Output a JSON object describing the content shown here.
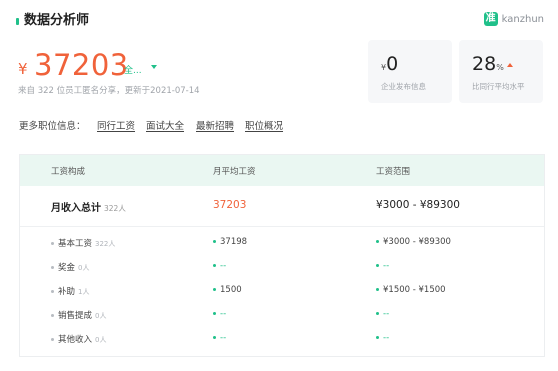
{
  "header": {
    "title": "数据分析师",
    "brand": "kanzhun",
    "brand_logo": "准"
  },
  "summary": {
    "currency": "¥",
    "salary": "37203",
    "region": "全...",
    "subline": "来自 322 位员工匿名分享，更新于2021-07-14"
  },
  "stats": [
    {
      "prefix": "¥",
      "value": "0",
      "unit": "",
      "label": "企业发布信息"
    },
    {
      "prefix": "",
      "value": "28",
      "unit": "%",
      "label": "比同行平均水平",
      "trend": "up"
    }
  ],
  "more": {
    "label": "更多职位信息：",
    "links": [
      "同行工资",
      "面试大全",
      "最新招聘",
      "职位概况"
    ]
  },
  "table": {
    "headers": [
      "工资构成",
      "月平均工资",
      "工资范围"
    ],
    "total": {
      "label": "月收入总计",
      "count": "322人",
      "avg": "37203",
      "range": "¥3000 - ¥89300"
    },
    "rows": [
      {
        "name": "基本工资",
        "count": "322人",
        "avg": "37198",
        "range": "¥3000 - ¥89300"
      },
      {
        "name": "奖金",
        "count": "0人",
        "avg": "--",
        "range": "--"
      },
      {
        "name": "补助",
        "count": "1人",
        "avg": "1500",
        "range": "¥1500 - ¥1500"
      },
      {
        "name": "销售提成",
        "count": "0人",
        "avg": "--",
        "range": "--"
      },
      {
        "name": "其他收入",
        "count": "0人",
        "avg": "--",
        "range": "--"
      }
    ]
  },
  "colors": {
    "accent": "#20c08a",
    "salary": "#f0623a",
    "table_header_bg": "#eaf7f2"
  }
}
